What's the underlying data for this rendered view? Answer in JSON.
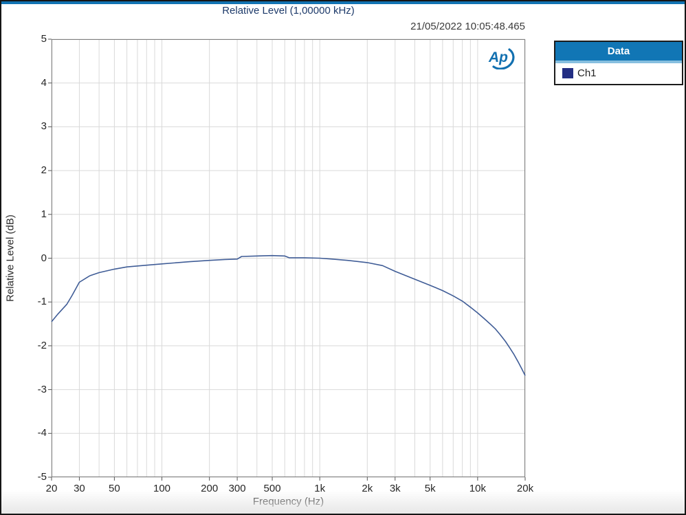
{
  "window": {
    "accent_color": "#1273b2"
  },
  "header": {
    "title": "Relative Level (1,00000 kHz)",
    "timestamp": "21/05/2022 10:05:48.465"
  },
  "logo": {
    "text": "Ap",
    "color": "#1270b0"
  },
  "legend": {
    "header": "Data",
    "header_bg": "#1176b5",
    "header_strip": "#87bfdf",
    "entries": [
      {
        "label": "Ch1",
        "color": "#232e83"
      }
    ]
  },
  "chart_data": {
    "type": "line",
    "title": "Relative Level (1,00000 kHz)",
    "timestamp": "21/05/2022 10:05:48.465",
    "xlabel": "Frequency (Hz)",
    "ylabel": "Relative Level (dB)",
    "x_scale": "log",
    "xlim": [
      20,
      20000
    ],
    "ylim": [
      -5,
      5
    ],
    "grid": true,
    "grid_color": "#d9d9d9",
    "axis_color": "#7f7f7f",
    "tick_color": "#555555",
    "y_tick_values": [
      5,
      4,
      3,
      2,
      1,
      0,
      -1,
      -2,
      -3,
      -4,
      -5
    ],
    "x_gridlines": [
      20,
      30,
      40,
      50,
      60,
      70,
      80,
      90,
      100,
      200,
      300,
      400,
      500,
      600,
      700,
      800,
      900,
      1000,
      2000,
      3000,
      4000,
      5000,
      6000,
      7000,
      8000,
      9000,
      10000,
      20000
    ],
    "x_tick_labels": [
      {
        "value": 20,
        "label": "20"
      },
      {
        "value": 30,
        "label": "30"
      },
      {
        "value": 50,
        "label": "50"
      },
      {
        "value": 100,
        "label": "100"
      },
      {
        "value": 200,
        "label": "200"
      },
      {
        "value": 300,
        "label": "300"
      },
      {
        "value": 500,
        "label": "500"
      },
      {
        "value": 1000,
        "label": "1k"
      },
      {
        "value": 2000,
        "label": "2k"
      },
      {
        "value": 3000,
        "label": "3k"
      },
      {
        "value": 5000,
        "label": "5k"
      },
      {
        "value": 10000,
        "label": "10k"
      },
      {
        "value": 20000,
        "label": "20k"
      }
    ],
    "legend_position": "top-right",
    "series": [
      {
        "name": "Ch1",
        "color": "#3f5c96",
        "legend_color": "#232e83",
        "points": [
          [
            20,
            -1.45
          ],
          [
            22,
            -1.27
          ],
          [
            25,
            -1.05
          ],
          [
            27,
            -0.85
          ],
          [
            30,
            -0.55
          ],
          [
            35,
            -0.4
          ],
          [
            40,
            -0.33
          ],
          [
            50,
            -0.25
          ],
          [
            60,
            -0.2
          ],
          [
            80,
            -0.16
          ],
          [
            100,
            -0.13
          ],
          [
            150,
            -0.08
          ],
          [
            200,
            -0.05
          ],
          [
            250,
            -0.03
          ],
          [
            300,
            -0.02
          ],
          [
            320,
            0.04
          ],
          [
            400,
            0.05
          ],
          [
            500,
            0.06
          ],
          [
            600,
            0.05
          ],
          [
            640,
            0.01
          ],
          [
            800,
            0.01
          ],
          [
            1000,
            0.0
          ],
          [
            1200,
            -0.02
          ],
          [
            1500,
            -0.05
          ],
          [
            2000,
            -0.1
          ],
          [
            2500,
            -0.17
          ],
          [
            3000,
            -0.3
          ],
          [
            4000,
            -0.48
          ],
          [
            5000,
            -0.62
          ],
          [
            6000,
            -0.74
          ],
          [
            7000,
            -0.86
          ],
          [
            8000,
            -0.98
          ],
          [
            9000,
            -1.12
          ],
          [
            10000,
            -1.25
          ],
          [
            11000,
            -1.38
          ],
          [
            12000,
            -1.5
          ],
          [
            13000,
            -1.62
          ],
          [
            14000,
            -1.76
          ],
          [
            15000,
            -1.9
          ],
          [
            16000,
            -2.05
          ],
          [
            17000,
            -2.2
          ],
          [
            18000,
            -2.36
          ],
          [
            19000,
            -2.52
          ],
          [
            20000,
            -2.68
          ]
        ]
      }
    ]
  }
}
